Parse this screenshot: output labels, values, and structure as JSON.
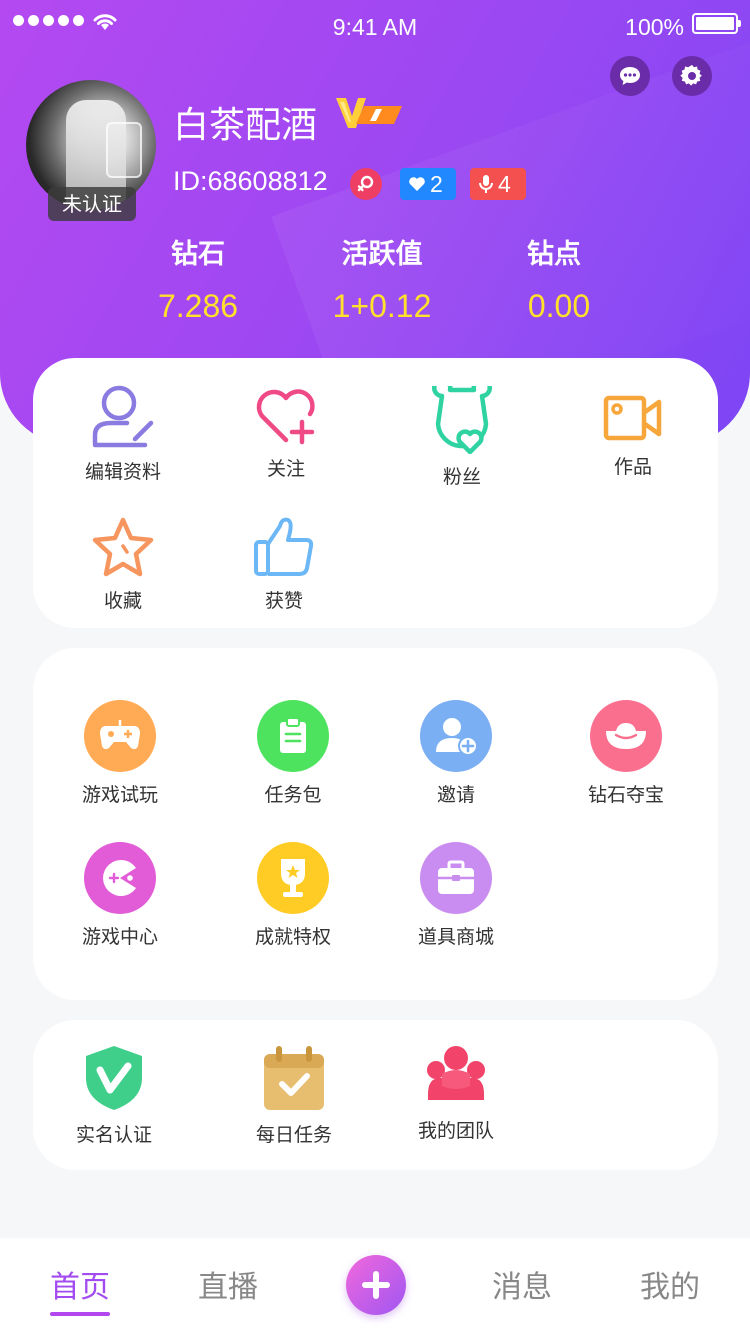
{
  "status_bar": {
    "time": "9:41 AM",
    "battery": "100%"
  },
  "profile": {
    "name": "白茶配酒",
    "id": "ID:68608812",
    "cert_status": "未认证",
    "tag_fans": "2",
    "tag_mic": "4"
  },
  "stats": [
    {
      "label": "钻石",
      "value": "7.286"
    },
    {
      "label": "活跃值",
      "value": "1+0.12"
    },
    {
      "label": "钻点",
      "value": "0.00"
    }
  ],
  "quick_menu": [
    {
      "label": "编辑资料",
      "icon": "edit-profile-icon",
      "color": "#8a7be0"
    },
    {
      "label": "关注",
      "icon": "heart-plus-icon",
      "color": "#f04a86"
    },
    {
      "label": "粉丝",
      "icon": "fans-icon",
      "color": "#2ed3a1"
    },
    {
      "label": "作品",
      "icon": "video-icon",
      "color": "#f6a63a"
    },
    {
      "label": "收藏",
      "icon": "star-icon",
      "color": "#f7955e"
    },
    {
      "label": "获赞",
      "icon": "thumbs-up-icon",
      "color": "#6cb7f5"
    }
  ],
  "services": [
    {
      "label": "游戏试玩",
      "icon": "gamepad-icon",
      "color": "#ffaa55"
    },
    {
      "label": "任务包",
      "icon": "clipboard-icon",
      "color": "#4ee35e"
    },
    {
      "label": "邀请",
      "icon": "invite-user-icon",
      "color": "#7aaff4"
    },
    {
      "label": "钻石夺宝",
      "icon": "ingot-icon",
      "color": "#fb6f8e"
    },
    {
      "label": "游戏中心",
      "icon": "pacman-icon",
      "color": "#e25cd8"
    },
    {
      "label": "成就特权",
      "icon": "trophy-icon",
      "color": "#ffcb25"
    },
    {
      "label": "道具商城",
      "icon": "shop-bag-icon",
      "color": "#c98cf0"
    }
  ],
  "others": [
    {
      "label": "实名认证",
      "icon": "shield-v-icon",
      "color": "#3fcf8a"
    },
    {
      "label": "每日任务",
      "icon": "calendar-check-icon",
      "color": "#e7bd6f"
    },
    {
      "label": "我的团队",
      "icon": "team-icon",
      "color": "#f2446a"
    }
  ],
  "tabbar": {
    "home": "首页",
    "live": "直播",
    "messages": "消息",
    "mine": "我的"
  }
}
